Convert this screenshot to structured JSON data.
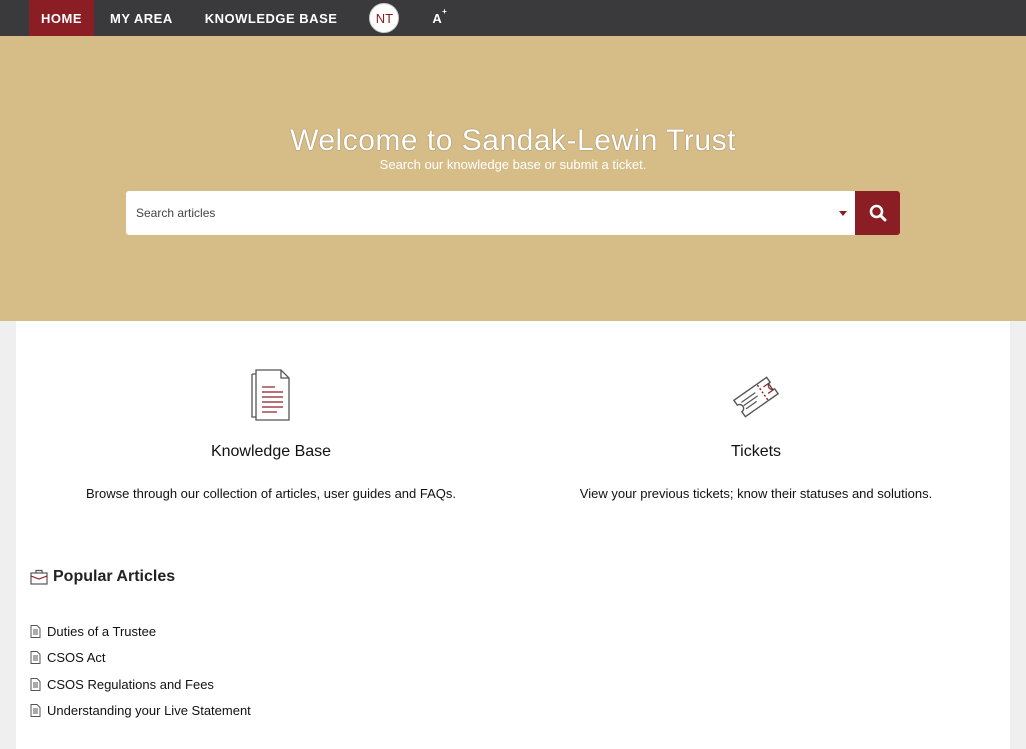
{
  "nav": {
    "items": [
      {
        "label": "HOME",
        "active": true
      },
      {
        "label": "MY AREA"
      },
      {
        "label": "KNOWLEDGE BASE"
      }
    ],
    "avatar_initials": "NT",
    "font_toggle_label": "A",
    "font_toggle_sup": "+"
  },
  "hero": {
    "title": "Welcome to Sandak-Lewin Trust",
    "subtitle": "Search our knowledge base or submit a ticket.",
    "search_placeholder": "Search articles"
  },
  "cards": {
    "knowledge_base": {
      "icon": "document-icon",
      "title": "Knowledge Base",
      "description": "Browse through our collection of articles, user guides and FAQs."
    },
    "tickets": {
      "icon": "ticket-icon",
      "title": "Tickets",
      "description": "View your previous tickets; know their statuses and solutions."
    }
  },
  "popular": {
    "heading": "Popular Articles",
    "icon": "briefcase-icon",
    "articles": [
      {
        "title": "Duties of a Trustee"
      },
      {
        "title": "CSOS Act"
      },
      {
        "title": "CSOS Regulations and Fees"
      },
      {
        "title": "Understanding your Live Statement"
      }
    ]
  },
  "colors": {
    "accent": "#8b1d24",
    "nav_bg": "#3a3a3c",
    "hero_bg": "#d6bd88"
  }
}
